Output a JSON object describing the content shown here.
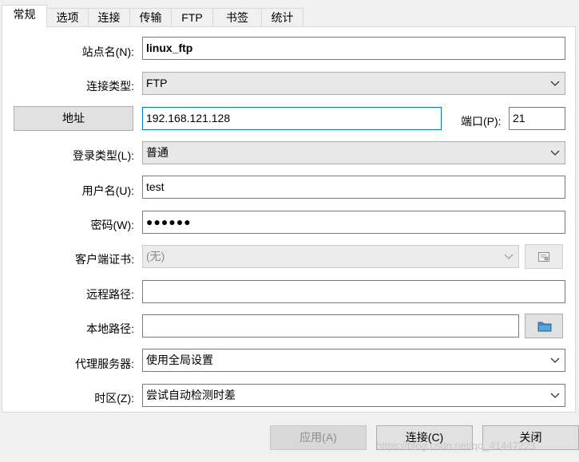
{
  "tabs": [
    "常规",
    "选项",
    "连接",
    "传输",
    "FTP",
    "书签",
    "统计"
  ],
  "form": {
    "site_name_label": "站点名(N):",
    "site_name_value": "linux_ftp",
    "conn_type_label": "连接类型:",
    "conn_type_value": "FTP",
    "address_button": "地址",
    "address_value": "192.168.121.128",
    "port_label": "端口(P):",
    "port_value": "21",
    "login_type_label": "登录类型(L):",
    "login_type_value": "普通",
    "username_label": "用户名(U):",
    "username_value": "test",
    "password_label": "密码(W):",
    "password_value": "●●●●●●",
    "client_cert_label": "客户端证书:",
    "client_cert_value": "(无)",
    "remote_path_label": "远程路径:",
    "remote_path_value": "",
    "local_path_label": "本地路径:",
    "local_path_value": "",
    "proxy_label": "代理服务器:",
    "proxy_value": "使用全局设置",
    "timezone_label": "时区(Z):",
    "timezone_value": "尝试自动检测时差"
  },
  "footer": {
    "apply": "应用(A)",
    "connect": "连接(C)",
    "close": "关闭"
  },
  "watermark": "https://blog.csdn.net/qq_41447223",
  "colors": {
    "focus_border": "#0078d7",
    "folder_icon": "#3c8dc5"
  }
}
